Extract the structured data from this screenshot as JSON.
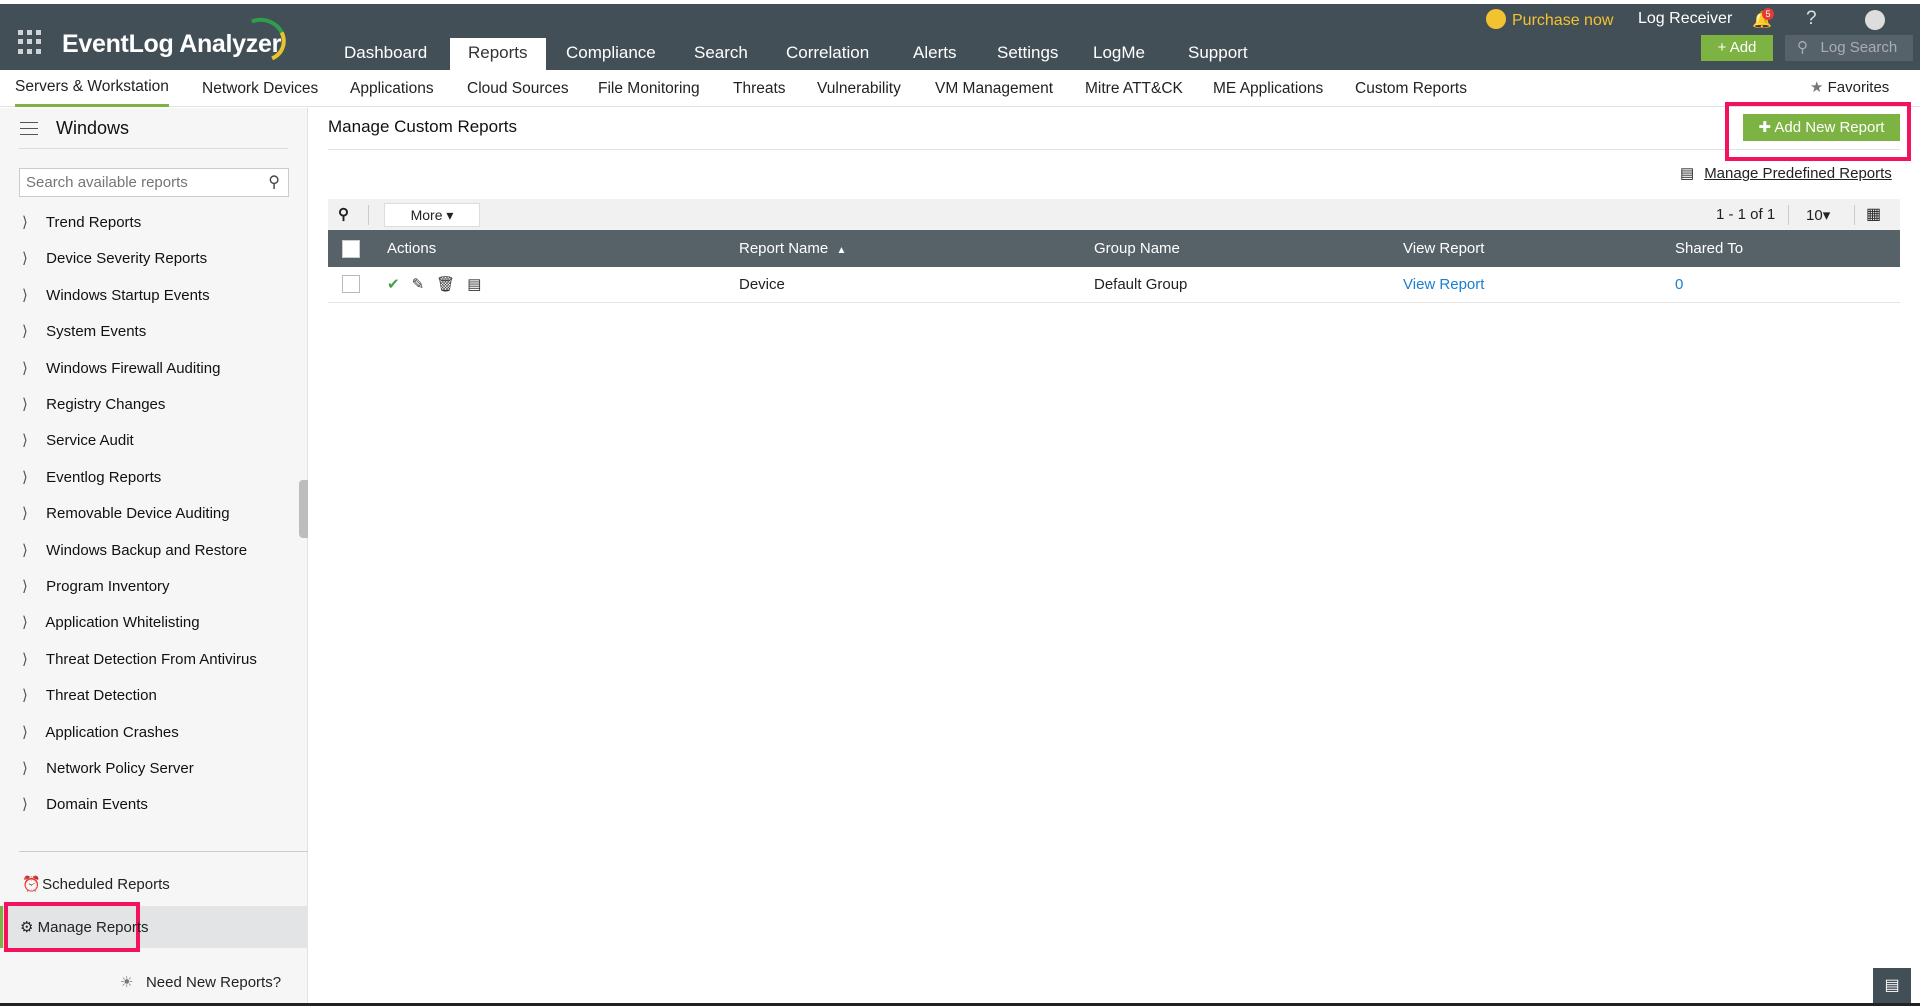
{
  "app": {
    "name": "EventLog Analyzer"
  },
  "topnav": [
    "Dashboard",
    "Reports",
    "Compliance",
    "Search",
    "Correlation",
    "Alerts",
    "Settings",
    "LogMe",
    "Support"
  ],
  "topright": {
    "purchase": "Purchase now",
    "log_receiver": "Log Receiver",
    "notifications": "5",
    "help": "?",
    "add": "Add",
    "log_search": "Log Search"
  },
  "subnav": [
    "Servers & Workstation",
    "Network Devices",
    "Applications",
    "Cloud Sources",
    "File Monitoring",
    "Threats",
    "Vulnerability",
    "VM Management",
    "Mitre ATT&CK",
    "ME Applications",
    "Custom Reports"
  ],
  "favorites": "Favorites",
  "sidebar": {
    "title": "Windows",
    "search_placeholder": "Search available reports",
    "items": [
      "Trend Reports",
      "Device Severity Reports",
      "Windows Startup Events",
      "System Events",
      "Windows Firewall Auditing",
      "Registry Changes",
      "Service Audit",
      "Eventlog Reports",
      "Removable Device Auditing",
      "Windows Backup and Restore",
      "Program Inventory",
      "Application Whitelisting",
      "Threat Detection From Antivirus",
      "Threat Detection",
      "Application Crashes",
      "Network Policy Server",
      "Domain Events"
    ],
    "scheduled": "Scheduled Reports",
    "manage": "Manage Reports",
    "need_new": "Need New Reports?"
  },
  "main": {
    "title": "Manage Custom Reports",
    "add_new": "Add New Report",
    "manage_predefined": "Manage Predefined Reports",
    "more": "More",
    "pagination": "1 - 1 of 1",
    "page_size": "10",
    "columns": [
      "Actions",
      "Report Name",
      "Group Name",
      "View Report",
      "Shared To"
    ],
    "rows": [
      {
        "report_name": "Device",
        "group_name": "Default Group",
        "view_report": "View Report",
        "shared_to": "0"
      }
    ]
  },
  "colors": {
    "header": "#434f57",
    "accent": "#7cb342",
    "highlight": "#f3135c",
    "link": "#1a7fd0"
  }
}
